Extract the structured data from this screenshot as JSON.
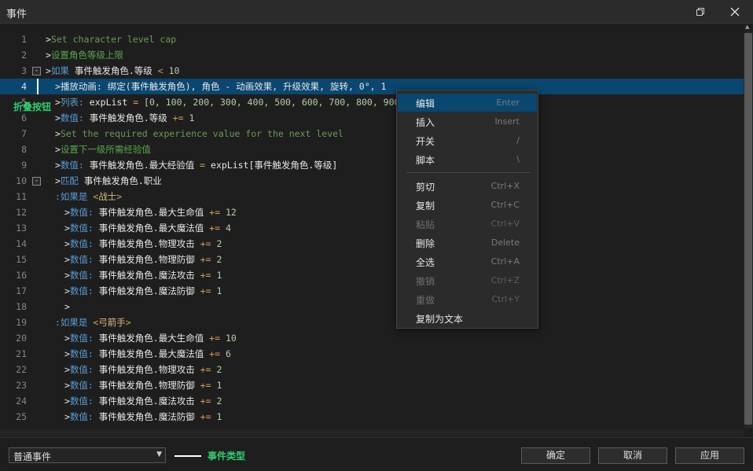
{
  "window": {
    "title": "事件",
    "restore_icon": "restore-window-icon",
    "close_icon": "close-icon"
  },
  "editor": {
    "lines": [
      {
        "n": "1",
        "indent": 0,
        "tokens": [
          [
            "arrow",
            ">"
          ],
          [
            "cm",
            "Set character level cap"
          ]
        ]
      },
      {
        "n": "2",
        "indent": 0,
        "tokens": [
          [
            "arrow",
            ">"
          ],
          [
            "cmzh",
            "设置角色等级上限"
          ]
        ]
      },
      {
        "n": "3",
        "indent": 0,
        "fold": "-",
        "tokens": [
          [
            "arrow",
            ">"
          ],
          [
            "kw",
            "如果 "
          ],
          [
            "wh",
            "事件触发角色.等级 "
          ],
          [
            "op",
            "< "
          ],
          [
            "num",
            "10"
          ]
        ]
      },
      {
        "n": "4",
        "indent": 1,
        "selected": true,
        "tokens": [
          [
            "arrow",
            ">"
          ],
          [
            "wh",
            "播放动画: 绑定(事件触发角色), 角色 - 动画效果, 升级效果, 旋转, 0°, 1"
          ]
        ]
      },
      {
        "n": "5",
        "indent": 1,
        "tokens": [
          [
            "arrow",
            ">"
          ],
          [
            "kw",
            "列表: "
          ],
          [
            "wh",
            "expList "
          ],
          [
            "op",
            "= "
          ],
          [
            "num",
            "[0, 100, 200, 300, 400, 500, 600, 700, 800, 900]"
          ]
        ]
      },
      {
        "n": "6",
        "indent": 1,
        "tokens": [
          [
            "arrow",
            ">"
          ],
          [
            "kw",
            "数值: "
          ],
          [
            "wh",
            "事件触发角色.等级 "
          ],
          [
            "op",
            "+= "
          ],
          [
            "num",
            "1"
          ]
        ]
      },
      {
        "n": "7",
        "indent": 1,
        "tokens": [
          [
            "arrow",
            ">"
          ],
          [
            "cm",
            "Set the required experience value for the next level"
          ]
        ]
      },
      {
        "n": "8",
        "indent": 1,
        "tokens": [
          [
            "arrow",
            ">"
          ],
          [
            "cmzh",
            "设置下一级所需经验值"
          ]
        ]
      },
      {
        "n": "9",
        "indent": 1,
        "tokens": [
          [
            "arrow",
            ">"
          ],
          [
            "kw",
            "数值: "
          ],
          [
            "wh",
            "事件触发角色.最大经验值 "
          ],
          [
            "op",
            "= "
          ],
          [
            "wh",
            "expList[事件触发角色.等级]"
          ]
        ]
      },
      {
        "n": "10",
        "indent": 1,
        "fold": "-",
        "tokens": [
          [
            "arrow",
            ">"
          ],
          [
            "kw",
            "匹配 "
          ],
          [
            "wh",
            "事件触发角色.职业"
          ]
        ]
      },
      {
        "n": "11",
        "indent": 1,
        "tokens": [
          [
            "kw",
            ":如果是 "
          ],
          [
            "op",
            "<"
          ],
          [
            "case",
            "战士"
          ],
          [
            "op",
            ">"
          ]
        ]
      },
      {
        "n": "12",
        "indent": 2,
        "tokens": [
          [
            "arrow",
            ">"
          ],
          [
            "kw",
            "数值: "
          ],
          [
            "wh",
            "事件触发角色.最大生命值 "
          ],
          [
            "op",
            "+= "
          ],
          [
            "num",
            "12"
          ]
        ]
      },
      {
        "n": "13",
        "indent": 2,
        "tokens": [
          [
            "arrow",
            ">"
          ],
          [
            "kw",
            "数值: "
          ],
          [
            "wh",
            "事件触发角色.最大魔法值 "
          ],
          [
            "op",
            "+= "
          ],
          [
            "num",
            "4"
          ]
        ]
      },
      {
        "n": "14",
        "indent": 2,
        "tokens": [
          [
            "arrow",
            ">"
          ],
          [
            "kw",
            "数值: "
          ],
          [
            "wh",
            "事件触发角色.物理攻击 "
          ],
          [
            "op",
            "+= "
          ],
          [
            "num",
            "2"
          ]
        ]
      },
      {
        "n": "15",
        "indent": 2,
        "tokens": [
          [
            "arrow",
            ">"
          ],
          [
            "kw",
            "数值: "
          ],
          [
            "wh",
            "事件触发角色.物理防御 "
          ],
          [
            "op",
            "+= "
          ],
          [
            "num",
            "2"
          ]
        ]
      },
      {
        "n": "16",
        "indent": 2,
        "tokens": [
          [
            "arrow",
            ">"
          ],
          [
            "kw",
            "数值: "
          ],
          [
            "wh",
            "事件触发角色.魔法攻击 "
          ],
          [
            "op",
            "+= "
          ],
          [
            "num",
            "1"
          ]
        ]
      },
      {
        "n": "17",
        "indent": 2,
        "tokens": [
          [
            "arrow",
            ">"
          ],
          [
            "kw",
            "数值: "
          ],
          [
            "wh",
            "事件触发角色.魔法防御 "
          ],
          [
            "op",
            "+= "
          ],
          [
            "num",
            "1"
          ]
        ]
      },
      {
        "n": "18",
        "indent": 2,
        "tokens": [
          [
            "arrow",
            ">"
          ]
        ]
      },
      {
        "n": "19",
        "indent": 1,
        "tokens": [
          [
            "kw",
            ":如果是 "
          ],
          [
            "op",
            "<"
          ],
          [
            "case",
            "弓箭手"
          ],
          [
            "op",
            ">"
          ]
        ]
      },
      {
        "n": "20",
        "indent": 2,
        "tokens": [
          [
            "arrow",
            ">"
          ],
          [
            "kw",
            "数值: "
          ],
          [
            "wh",
            "事件触发角色.最大生命值 "
          ],
          [
            "op",
            "+= "
          ],
          [
            "num",
            "10"
          ]
        ]
      },
      {
        "n": "21",
        "indent": 2,
        "tokens": [
          [
            "arrow",
            ">"
          ],
          [
            "kw",
            "数值: "
          ],
          [
            "wh",
            "事件触发角色.最大魔法值 "
          ],
          [
            "op",
            "+= "
          ],
          [
            "num",
            "6"
          ]
        ]
      },
      {
        "n": "22",
        "indent": 2,
        "tokens": [
          [
            "arrow",
            ">"
          ],
          [
            "kw",
            "数值: "
          ],
          [
            "wh",
            "事件触发角色.物理攻击 "
          ],
          [
            "op",
            "+= "
          ],
          [
            "num",
            "2"
          ]
        ]
      },
      {
        "n": "23",
        "indent": 2,
        "tokens": [
          [
            "arrow",
            ">"
          ],
          [
            "kw",
            "数值: "
          ],
          [
            "wh",
            "事件触发角色.物理防御 "
          ],
          [
            "op",
            "+= "
          ],
          [
            "num",
            "1"
          ]
        ]
      },
      {
        "n": "24",
        "indent": 2,
        "tokens": [
          [
            "arrow",
            ">"
          ],
          [
            "kw",
            "数值: "
          ],
          [
            "wh",
            "事件触发角色.魔法攻击 "
          ],
          [
            "op",
            "+= "
          ],
          [
            "num",
            "2"
          ]
        ]
      },
      {
        "n": "25",
        "indent": 2,
        "tokens": [
          [
            "arrow",
            ">"
          ],
          [
            "kw",
            "数值: "
          ],
          [
            "wh",
            "事件触发角色.魔法防御 "
          ],
          [
            "op",
            "+= "
          ],
          [
            "num",
            "1"
          ]
        ]
      }
    ]
  },
  "annotations": {
    "fold_button": "折叠按钮",
    "event_type": "事件类型",
    "color": "#2ecc71"
  },
  "context_menu": {
    "items": [
      {
        "label": "编辑",
        "key": "Enter",
        "active": true
      },
      {
        "label": "插入",
        "key": "Insert"
      },
      {
        "label": "开关",
        "key": "/"
      },
      {
        "label": "脚本",
        "key": "\\"
      },
      {
        "sep": true
      },
      {
        "label": "剪切",
        "key": "Ctrl+X"
      },
      {
        "label": "复制",
        "key": "Ctrl+C"
      },
      {
        "label": "粘贴",
        "key": "Ctrl+V",
        "disabled": true
      },
      {
        "label": "删除",
        "key": "Delete"
      },
      {
        "label": "全选",
        "key": "Ctrl+A"
      },
      {
        "label": "撤销",
        "key": "Ctrl+Z",
        "disabled": true
      },
      {
        "label": "重做",
        "key": "Ctrl+Y",
        "disabled": true
      },
      {
        "label": "复制为文本",
        "key": ""
      }
    ]
  },
  "footer": {
    "event_type_value": "普通事件",
    "ok_label": "确定",
    "cancel_label": "取消",
    "apply_label": "应用"
  }
}
